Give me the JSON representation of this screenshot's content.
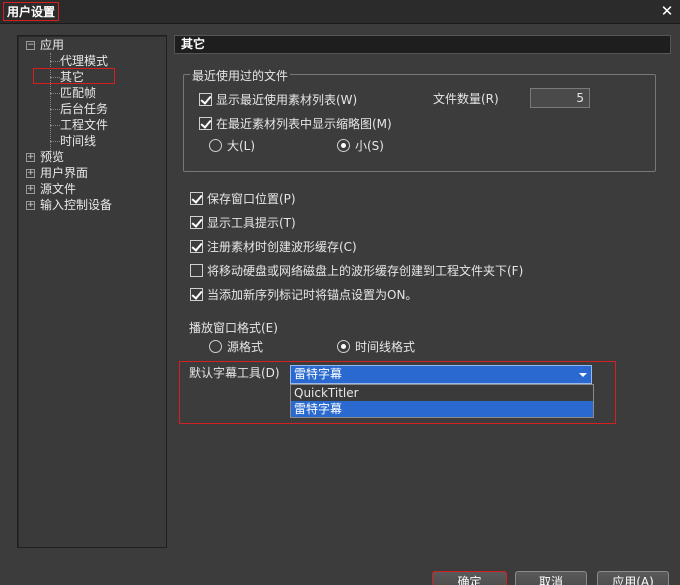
{
  "window": {
    "title": "用户设置",
    "close_glyph": "✕"
  },
  "tree": {
    "items": [
      {
        "label": "应用",
        "expander": "−"
      },
      {
        "label": "代理模式"
      },
      {
        "label": "其它"
      },
      {
        "label": "匹配帧"
      },
      {
        "label": "后台任务"
      },
      {
        "label": "工程文件"
      },
      {
        "label": "时间线"
      },
      {
        "label": "预览",
        "expander": "+"
      },
      {
        "label": "用户界面",
        "expander": "+"
      },
      {
        "label": "源文件",
        "expander": "+"
      },
      {
        "label": "输入控制设备",
        "expander": "+"
      }
    ],
    "selected": "其它"
  },
  "panel": {
    "header": "其它",
    "recent_group": {
      "legend": "最近使用过的文件",
      "show_recent": {
        "label": "显示最近使用素材列表(W)",
        "checked": true
      },
      "file_count": {
        "label": "文件数量(R)",
        "value": "5"
      },
      "show_thumbs": {
        "label": "在最近素材列表中显示缩略图(M)",
        "checked": true
      },
      "size_large": {
        "label": "大(L)",
        "checked": false
      },
      "size_small": {
        "label": "小(S)",
        "checked": true
      }
    },
    "options": [
      {
        "label": "保存窗口位置(P)",
        "checked": true
      },
      {
        "label": "显示工具提示(T)",
        "checked": true
      },
      {
        "label": "注册素材时创建波形缓存(C)",
        "checked": true
      },
      {
        "label": "将移动硬盘或网络磁盘上的波形缓存创建到工程文件夹下(F)",
        "checked": false
      },
      {
        "label": "当添加新序列标记时将锚点设置为ON。",
        "checked": true
      }
    ],
    "player_format": {
      "label": "播放窗口格式(E)",
      "source": {
        "label": "源格式",
        "checked": false
      },
      "timeline": {
        "label": "时间线格式",
        "checked": true
      }
    },
    "title_tool": {
      "label": "默认字幕工具(D)",
      "selected": "雷特字幕",
      "options": [
        "QuickTitler",
        "雷特字幕"
      ]
    }
  },
  "buttons": {
    "ok": "确定",
    "cancel": "取消",
    "apply": "应用(A)"
  }
}
